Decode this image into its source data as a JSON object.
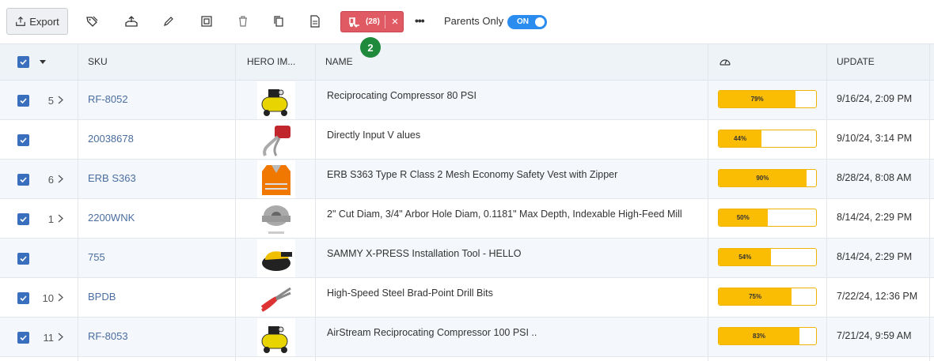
{
  "toolbar": {
    "export_label": "Export",
    "icons": [
      "tag-icon",
      "upload-icon",
      "edit-icon",
      "scan-icon",
      "trash-icon",
      "copy-icon",
      "document-icon"
    ],
    "filter_count": "(28)",
    "filter_close": "×",
    "badge": "2",
    "more": "•••",
    "parents_only_label": "Parents Only",
    "toggle_label": "ON"
  },
  "colors": {
    "accent": "#2b8cf0",
    "filter_chip": "#e05a64",
    "badge": "#1f8a3c",
    "progress": "#fbbc04",
    "checkbox": "#3a6fbd"
  },
  "table": {
    "headers": {
      "sku": "SKU",
      "hero_image": "HERO IM...",
      "name": "NAME",
      "completeness_icon": "gauge-icon",
      "update": "UPDATE"
    },
    "rows": [
      {
        "children": "5",
        "sku": "RF-8052",
        "image": "air-compressor",
        "name": "Reciprocating Compressor 80 PSI",
        "completeness": 79,
        "completeness_label": "79%",
        "update": "9/16/24, 2:09 PM"
      },
      {
        "children": "",
        "sku": "20038678",
        "image": "red-tool",
        "name": "Directly Input V alues",
        "completeness": 44,
        "completeness_label": "44%",
        "update": "9/10/24, 3:14 PM"
      },
      {
        "children": "6",
        "sku": "ERB S363",
        "image": "safety-vest",
        "name": "ERB S363 Type R Class 2 Mesh Economy Safety Vest with Zipper",
        "completeness": 90,
        "completeness_label": "90%",
        "update": "8/28/24, 8:08 AM"
      },
      {
        "children": "1",
        "sku": "2200WNK",
        "image": "feed-mill",
        "name": "2\" Cut Diam, 3/4\" Arbor Hole Diam, 0.1181\" Max Depth, Indexable High-Feed Mill",
        "completeness": 50,
        "completeness_label": "50%",
        "update": "8/14/24, 2:29 PM"
      },
      {
        "children": "",
        "sku": "755",
        "image": "sander",
        "name": "SAMMY X-PRESS Installation Tool - HELLO",
        "completeness": 54,
        "completeness_label": "54%",
        "update": "8/14/24, 2:29 PM"
      },
      {
        "children": "10",
        "sku": "BPDB",
        "image": "pliers",
        "name": "High-Speed Steel Brad-Point Drill Bits",
        "completeness": 75,
        "completeness_label": "75%",
        "update": "7/22/24, 12:36 PM"
      },
      {
        "children": "11",
        "sku": "RF-8053",
        "image": "air-compressor",
        "name": "AirStream Reciprocating Compressor 100 PSI ..",
        "completeness": 83,
        "completeness_label": "83%",
        "update": "7/21/24, 9:59 AM"
      }
    ]
  }
}
